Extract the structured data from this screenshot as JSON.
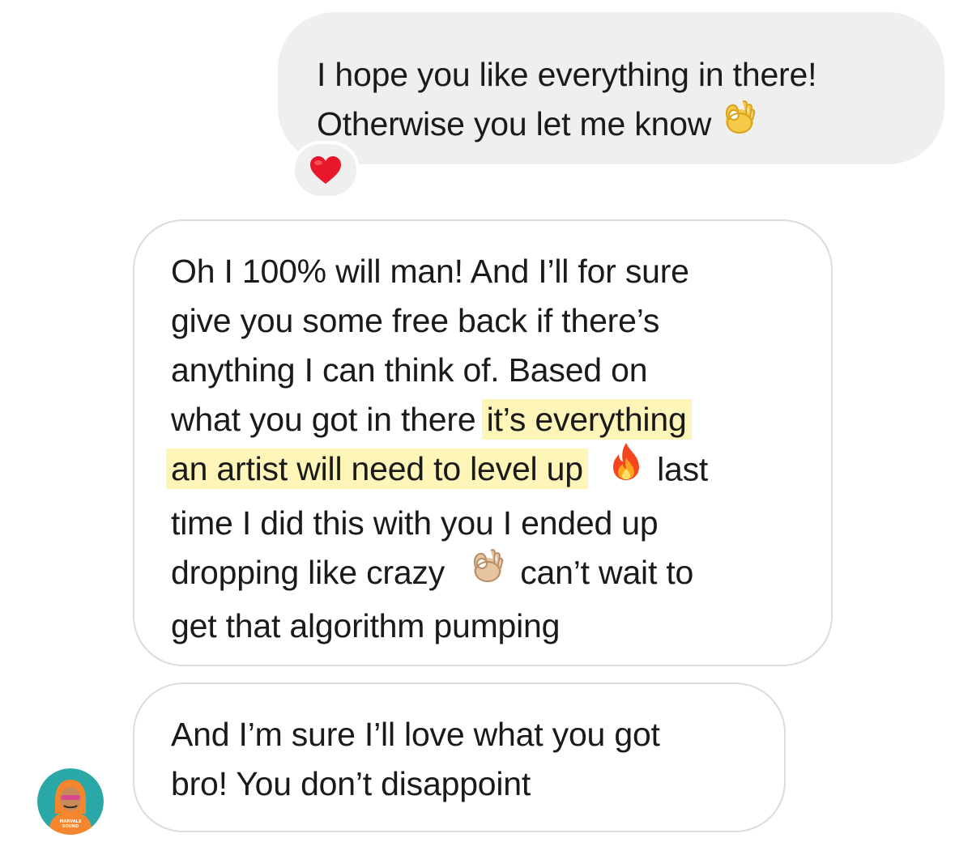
{
  "conversation": {
    "sent_message": {
      "lines": [
        "I hope you like everything in there!",
        "Otherwise you let me know"
      ],
      "trailing_emoji": "ok-hand-icon",
      "reaction": "heart-icon"
    },
    "received_messages": [
      {
        "lines": [
          {
            "text": "Oh I 100% will man! And I’ll for sure"
          },
          {
            "text": "give you some free back if there’s"
          },
          {
            "text": "anything I can think of. Based on"
          },
          {
            "text": "what you got in there ",
            "highlight": "it’s everything"
          },
          {
            "highlight": "an artist will need to level up",
            "emoji": "fire-icon",
            "text_after": "last"
          },
          {
            "text": "time I did this with you I ended up"
          },
          {
            "text": "dropping like crazy",
            "emoji": "ok-hand-icon",
            "text_after": "can’t wait to"
          },
          {
            "text": "get that algorithm pumping"
          }
        ]
      },
      {
        "lines": [
          {
            "text": "And I’m sure I’ll love what you got"
          },
          {
            "text": "bro! You don’t disappoint"
          }
        ]
      }
    ],
    "avatar": {
      "label_line1": "MARVALS",
      "label_line2": "SOUND"
    }
  },
  "colors": {
    "sent_bubble_bg": "#efefef",
    "received_bubble_border": "#dcdcdc",
    "highlight": "#fdf6b8",
    "heart": "#e8172b",
    "avatar_bg": "#2aa7a7",
    "avatar_figure": "#f5862e"
  }
}
